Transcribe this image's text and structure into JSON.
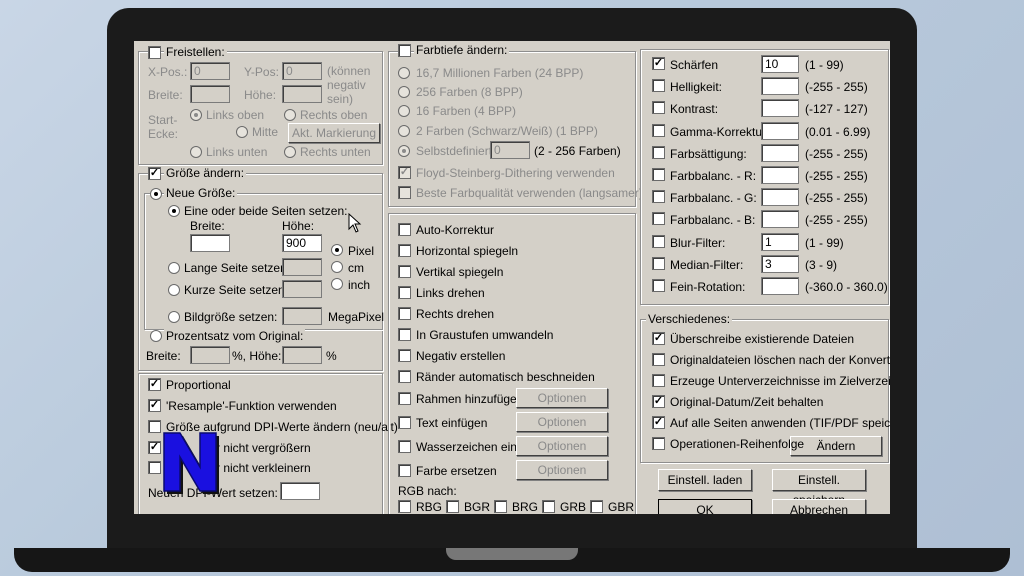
{
  "left": {
    "crop": {
      "label": "Freistellen:",
      "x_label": "X-Pos.:",
      "x_val": "0",
      "y_label": "Y-Pos:",
      "y_val": "0",
      "note": "(können negativ sein)",
      "width_label": "Breite:",
      "height_label": "Höhe:",
      "start_label": "Start-Ecke:",
      "corners": [
        "Links oben",
        "Rechts oben",
        "Mitte",
        "Links unten",
        "Rechts unten"
      ],
      "akt_button": "Akt. Markierung"
    },
    "resize": {
      "label": "Größe ändern:",
      "new_size": "Neue Größe:",
      "one_or_both": "Eine oder beide Seiten setzen:",
      "width_label": "Breite:",
      "height_label": "Höhe:",
      "height_val": "900",
      "units": [
        "Pixel",
        "cm",
        "inch"
      ],
      "long_side": "Lange Seite setzen:",
      "short_side": "Kurze Seite setzen:",
      "picture_size": "Bildgröße setzen:",
      "megapixel": "MegaPixel",
      "percent": "Prozentsatz vom Original:",
      "pct_width": "Breite:",
      "pct_mid": "%,  Höhe:",
      "pct_end": "%"
    },
    "options": {
      "proportional": "Proportional",
      "resample": "'Resample'-Funktion verwenden",
      "dpi": "Größe aufgrund DPI-Werte ändern (neu/alt)",
      "no_enlarge": "Nicht vergrößern",
      "no_shrink": "Nicht verkleinern",
      "new_dpi": "Neuen DPI-Wert setzen:",
      "no_enlarge_visible": "r nicht vergrößern",
      "no_shrink_visible": "r nicht verkleinern",
      "new_dpi_visible": "Neuen DPI-Wert setzen:"
    }
  },
  "middle": {
    "depth": {
      "label": "Farbtiefe ändern:",
      "items": [
        "16,7 Millionen Farben (24 BPP)",
        "256 Farben (8 BPP)",
        "16 Farben (4 BPP)",
        "2 Farben (Schwarz/Weiß) (1 BPP)",
        "Selbstdefiniert:"
      ],
      "custom_val": "0",
      "custom_range": "(2 - 256 Farben)",
      "floyd": "Floyd-Steinberg-Dithering verwenden",
      "best": "Beste Farbqualität verwenden (langsamer)"
    },
    "ops": [
      "Auto-Korrektur",
      "Horizontal spiegeln",
      "Vertikal spiegeln",
      "Links drehen",
      "Rechts drehen",
      "In Graustufen umwandeln",
      "Negativ erstellen",
      "Ränder automatisch beschneiden"
    ],
    "with_options": [
      "Rahmen hinzufügen",
      "Text einfügen",
      "Wasserzeichen einf.",
      "Farbe ersetzen"
    ],
    "options_button": "Optionen",
    "rgb_label": "RGB nach:",
    "rgb": [
      "RBG",
      "BGR",
      "BRG",
      "GRB",
      "GBR"
    ]
  },
  "right": {
    "filters": [
      {
        "label": "Schärfen",
        "value": "10",
        "range": "(1  -  99)",
        "checked": true
      },
      {
        "label": "Helligkeit:",
        "value": "",
        "range": "(-255  -  255)",
        "checked": false
      },
      {
        "label": "Kontrast:",
        "value": "",
        "range": "(-127  -  127)",
        "checked": false
      },
      {
        "label": "Gamma-Korrektur:",
        "value": "",
        "range": "(0.01  -  6.99)",
        "checked": false
      },
      {
        "label": "Farbsättigung:",
        "value": "",
        "range": "(-255  -  255)",
        "checked": false
      },
      {
        "label": "Farbbalanc. - R:",
        "value": "",
        "range": "(-255  -  255)",
        "checked": false
      },
      {
        "label": "Farbbalanc. - G:",
        "value": "",
        "range": "(-255  -  255)",
        "checked": false
      },
      {
        "label": "Farbbalanc. - B:",
        "value": "",
        "range": "(-255  -  255)",
        "checked": false
      },
      {
        "label": "Blur-Filter:",
        "value": "1",
        "range": "(1  -  99)",
        "checked": false
      },
      {
        "label": "Median-Filter:",
        "value": "3",
        "range": "(3  -  9)",
        "checked": false
      },
      {
        "label": "Fein-Rotation:",
        "value": "",
        "range": "(-360.0  -  360.0)",
        "checked": false
      }
    ],
    "misc_label": "Verschiedenes:",
    "misc": [
      {
        "label": "Überschreibe existierende Dateien",
        "checked": true
      },
      {
        "label": "Originaldateien löschen nach der Konvertier.",
        "checked": false
      },
      {
        "label": "Erzeuge Unterverzeichnisse im Zielverzeichn.",
        "checked": false
      },
      {
        "label": "Original-Datum/Zeit behalten",
        "checked": true
      },
      {
        "label": "Auf alle Seiten anwenden (TIF/PDF speichern",
        "checked": true
      },
      {
        "label": "Operationen-Reihenfolge",
        "checked": false
      }
    ],
    "change_button": "Ändern",
    "load_button": "Einstell. laden",
    "save_button": "Einstell. speichern",
    "ok_button": "OK",
    "cancel_button": "Abbrechen"
  },
  "logo_letter": "N"
}
